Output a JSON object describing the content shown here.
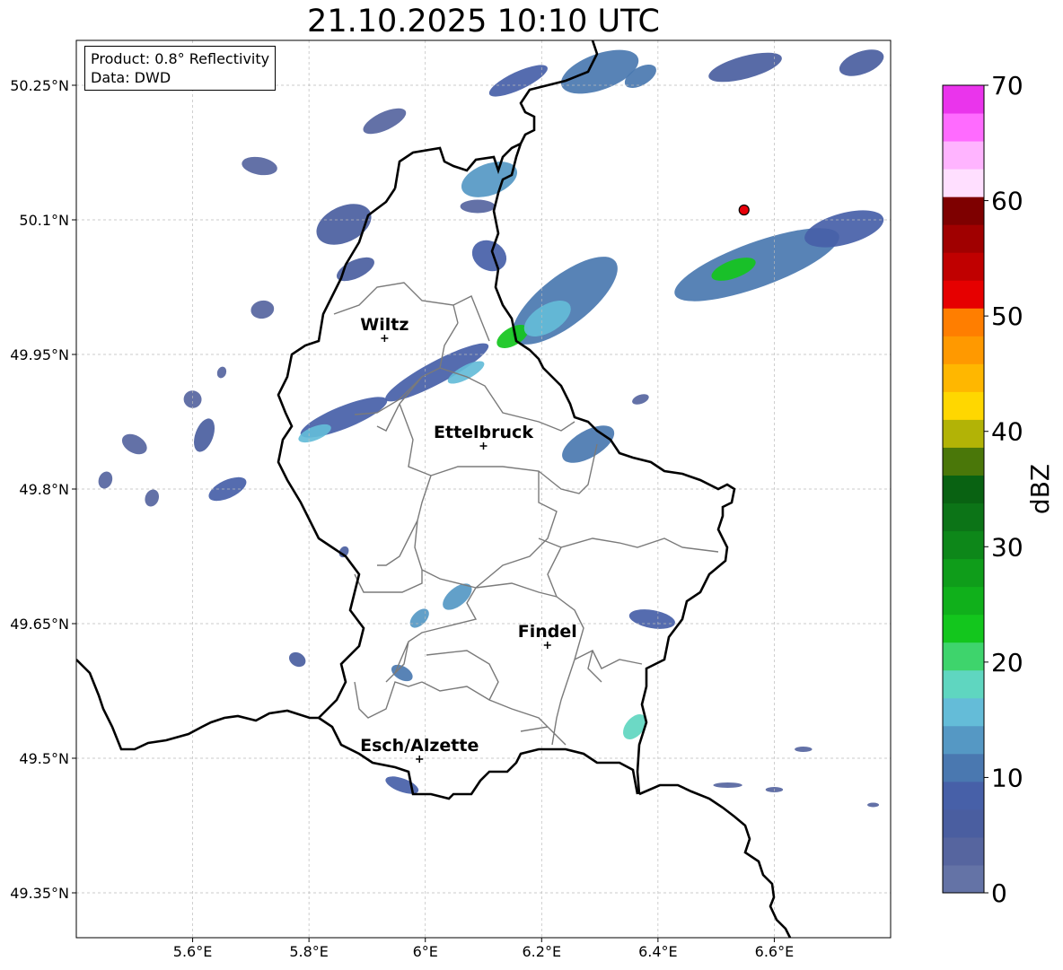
{
  "title": "21.10.2025 10:10 UTC",
  "info": {
    "product": "Product: 0.8° Reflectivity",
    "data": "Data: DWD"
  },
  "map_extent": {
    "lon": [
      5.4,
      6.8
    ],
    "lat": [
      49.3,
      50.3
    ]
  },
  "lon_ticks": [
    {
      "value": 5.6,
      "label": "5.6°E"
    },
    {
      "value": 5.8,
      "label": "5.8°E"
    },
    {
      "value": 6.0,
      "label": "6°E"
    },
    {
      "value": 6.2,
      "label": "6.2°E"
    },
    {
      "value": 6.4,
      "label": "6.4°E"
    },
    {
      "value": 6.6,
      "label": "6.6°E"
    }
  ],
  "lat_ticks": [
    {
      "value": 50.25,
      "label": "50.25°N"
    },
    {
      "value": 50.1,
      "label": "50.1°N"
    },
    {
      "value": 49.95,
      "label": "49.95°N"
    },
    {
      "value": 49.8,
      "label": "49.8°N"
    },
    {
      "value": 49.65,
      "label": "49.65°N"
    },
    {
      "value": 49.5,
      "label": "49.5°N"
    },
    {
      "value": 49.35,
      "label": "49.35°N"
    }
  ],
  "cities": [
    {
      "name": "Wiltz",
      "lon": 5.93,
      "lat": 49.968
    },
    {
      "name": "Ettelbruck",
      "lon": 6.1,
      "lat": 49.848
    },
    {
      "name": "Findel",
      "lon": 6.21,
      "lat": 49.626
    },
    {
      "name": "Esch/Alzette",
      "lon": 5.99,
      "lat": 49.499
    }
  ],
  "radar_site": {
    "lon": 6.548,
    "lat": 50.111,
    "color": "#e8000a"
  },
  "colorbar": {
    "label": "dBZ",
    "min": 0,
    "max": 70,
    "ticks": [
      0,
      10,
      20,
      30,
      40,
      50,
      60,
      70
    ],
    "colors": [
      "#6473a6",
      "#56659f",
      "#4a5ea0",
      "#4760a8",
      "#4a78b0",
      "#5598c4",
      "#64bcd8",
      "#5fd6c0",
      "#3ed46c",
      "#13c61d",
      "#10b01b",
      "#0f9d1a",
      "#0d8719",
      "#0c7417",
      "#096212",
      "#4a7709",
      "#b2b306",
      "#ffd700",
      "#ffb700",
      "#ff9900",
      "#ff7e00",
      "#e60000",
      "#c00000",
      "#a00000",
      "#7e0000",
      "#ffdfff",
      "#ffb4ff",
      "#ff6bff",
      "#ea34ec"
    ]
  },
  "echoes": [
    {
      "lat": 50.255,
      "lon": 6.16,
      "len": 0.11,
      "w": 0.02,
      "ang": 25,
      "dbz": 8
    },
    {
      "lat": 50.265,
      "lon": 6.3,
      "len": 0.14,
      "w": 0.04,
      "ang": 20,
      "dbz": 12
    },
    {
      "lat": 50.26,
      "lon": 6.37,
      "len": 0.06,
      "w": 0.02,
      "ang": 30,
      "dbz": 10
    },
    {
      "lat": 50.27,
      "lon": 6.55,
      "len": 0.13,
      "w": 0.025,
      "ang": 15,
      "dbz": 5
    },
    {
      "lat": 50.275,
      "lon": 6.75,
      "len": 0.08,
      "w": 0.025,
      "ang": 20,
      "dbz": 6
    },
    {
      "lat": 50.21,
      "lon": 5.93,
      "len": 0.08,
      "w": 0.02,
      "ang": 25,
      "dbz": 4
    },
    {
      "lat": 50.145,
      "lon": 6.11,
      "len": 0.1,
      "w": 0.035,
      "ang": 20,
      "dbz": 14
    },
    {
      "lat": 50.095,
      "lon": 5.86,
      "len": 0.1,
      "w": 0.04,
      "ang": 25,
      "dbz": 7
    },
    {
      "lat": 50.115,
      "lon": 6.09,
      "len": 0.06,
      "w": 0.015,
      "ang": 0,
      "dbz": 4
    },
    {
      "lat": 50.045,
      "lon": 5.88,
      "len": 0.07,
      "w": 0.02,
      "ang": 25,
      "dbz": 5
    },
    {
      "lat": 50.06,
      "lon": 6.11,
      "len": 0.05,
      "w": 0.04,
      "ang": 60,
      "dbz": 8
    },
    {
      "lat": 50.16,
      "lon": 5.715,
      "len": 0.03,
      "w": 0.04,
      "ang": 80,
      "dbz": 4
    },
    {
      "lat": 50.0,
      "lon": 5.72,
      "len": 0.04,
      "w": 0.02,
      "ang": 10,
      "dbz": 4
    },
    {
      "lat": 50.01,
      "lon": 6.24,
      "len": 0.22,
      "w": 0.055,
      "ang": 38,
      "dbz": 12
    },
    {
      "lat": 49.97,
      "lon": 6.15,
      "len": 0.06,
      "w": 0.02,
      "ang": 30,
      "dbz": 22
    },
    {
      "lat": 49.99,
      "lon": 6.21,
      "len": 0.09,
      "w": 0.03,
      "ang": 32,
      "dbz": 16
    },
    {
      "lat": 50.05,
      "lon": 6.57,
      "len": 0.3,
      "w": 0.05,
      "ang": 20,
      "dbz": 10
    },
    {
      "lat": 50.045,
      "lon": 6.53,
      "len": 0.08,
      "w": 0.02,
      "ang": 20,
      "dbz": 23
    },
    {
      "lat": 50.09,
      "lon": 6.72,
      "len": 0.14,
      "w": 0.035,
      "ang": 15,
      "dbz": 8
    },
    {
      "lat": 49.93,
      "lon": 6.02,
      "len": 0.2,
      "w": 0.025,
      "ang": 28,
      "dbz": 9
    },
    {
      "lat": 49.93,
      "lon": 6.07,
      "len": 0.07,
      "w": 0.015,
      "ang": 28,
      "dbz": 16
    },
    {
      "lat": 49.88,
      "lon": 5.86,
      "len": 0.16,
      "w": 0.025,
      "ang": 22,
      "dbz": 9
    },
    {
      "lat": 49.862,
      "lon": 5.81,
      "len": 0.06,
      "w": 0.015,
      "ang": 22,
      "dbz": 16
    },
    {
      "lat": 49.85,
      "lon": 6.28,
      "len": 0.1,
      "w": 0.03,
      "ang": 30,
      "dbz": 12
    },
    {
      "lat": 49.8,
      "lon": 5.66,
      "len": 0.07,
      "w": 0.02,
      "ang": 25,
      "dbz": 8
    },
    {
      "lat": 49.86,
      "lon": 5.62,
      "len": 0.06,
      "w": 0.02,
      "ang": 70,
      "dbz": 6
    },
    {
      "lat": 49.85,
      "lon": 5.5,
      "len": 0.03,
      "w": 0.03,
      "ang": 60,
      "dbz": 4
    },
    {
      "lat": 49.81,
      "lon": 5.45,
      "len": 0.03,
      "w": 0.015,
      "ang": 70,
      "dbz": 4
    },
    {
      "lat": 49.79,
      "lon": 5.53,
      "len": 0.03,
      "w": 0.015,
      "ang": 70,
      "dbz": 4
    },
    {
      "lat": 49.68,
      "lon": 6.055,
      "len": 0.06,
      "w": 0.02,
      "ang": 40,
      "dbz": 14
    },
    {
      "lat": 49.656,
      "lon": 5.99,
      "len": 0.04,
      "w": 0.015,
      "ang": 45,
      "dbz": 14
    },
    {
      "lat": 49.595,
      "lon": 5.96,
      "len": 0.04,
      "w": 0.015,
      "ang": -30,
      "dbz": 12
    },
    {
      "lat": 49.61,
      "lon": 5.78,
      "len": 0.03,
      "w": 0.015,
      "ang": -30,
      "dbz": 6
    },
    {
      "lat": 49.655,
      "lon": 6.39,
      "len": 0.08,
      "w": 0.02,
      "ang": -10,
      "dbz": 8
    },
    {
      "lat": 49.535,
      "lon": 6.36,
      "len": 0.05,
      "w": 0.02,
      "ang": 50,
      "dbz": 18
    },
    {
      "lat": 49.47,
      "lon": 5.96,
      "len": 0.06,
      "w": 0.015,
      "ang": -20,
      "dbz": 8
    },
    {
      "lat": 49.47,
      "lon": 6.52,
      "len": 0.05,
      "w": 0.006,
      "ang": 0,
      "dbz": 4
    },
    {
      "lat": 49.51,
      "lon": 6.65,
      "len": 0.03,
      "w": 0.006,
      "ang": 0,
      "dbz": 4
    },
    {
      "lat": 49.465,
      "lon": 6.6,
      "len": 0.03,
      "w": 0.006,
      "ang": 0,
      "dbz": 4
    },
    {
      "lat": 49.448,
      "lon": 6.77,
      "len": 0.02,
      "w": 0.005,
      "ang": 0,
      "dbz": 4
    },
    {
      "lat": 49.73,
      "lon": 5.86,
      "len": 0.02,
      "w": 0.01,
      "ang": 60,
      "dbz": 5
    },
    {
      "lat": 49.9,
      "lon": 5.6,
      "len": 0.03,
      "w": 0.02,
      "ang": 70,
      "dbz": 4
    },
    {
      "lat": 49.93,
      "lon": 5.65,
      "len": 0.02,
      "w": 0.01,
      "ang": 70,
      "dbz": 4
    },
    {
      "lat": 49.9,
      "lon": 6.37,
      "len": 0.03,
      "w": 0.01,
      "ang": 20,
      "dbz": 4
    }
  ]
}
